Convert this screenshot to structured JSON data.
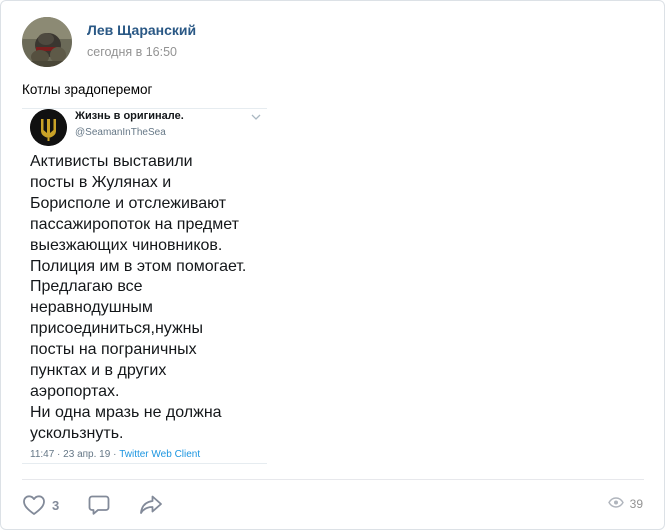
{
  "post": {
    "author": "Лев Щаранский",
    "time": "сегодня в 16:50",
    "text": "Котлы зрадоперемог"
  },
  "tweet": {
    "name": "Жизнь в оригинале.",
    "handle": "@SeamanInTheSea",
    "lines": [
      "Активисты выставили",
      "посты в Жулянах и",
      "Борисполе и отслеживают",
      "пассажиропоток на предмет",
      "выезжающих чиновников.",
      "Полиция им в этом помогает.",
      "Предлагаю все",
      "неравнодушным",
      "присоединиться,нужны",
      "посты на пограничных",
      "пунктах и в других",
      "аэропортах.",
      "Ни одна мразь не должна",
      "ускользнуть."
    ],
    "meta_time": "11:47 · 23 апр. 19 · ",
    "client": "Twitter Web Client"
  },
  "actions": {
    "likes": "3",
    "views": "39"
  },
  "icons": {
    "avatar": "user-avatar-photo",
    "tweet_avatar": "trident-emblem-icon",
    "chevron": "chevron-down-icon",
    "like": "heart-icon",
    "comment": "comment-icon",
    "share": "share-icon",
    "views": "eye-icon"
  },
  "colors": {
    "author_link": "#2a5885",
    "muted": "#939393",
    "icon": "#828a99",
    "twitter_link": "#1b95e0"
  }
}
